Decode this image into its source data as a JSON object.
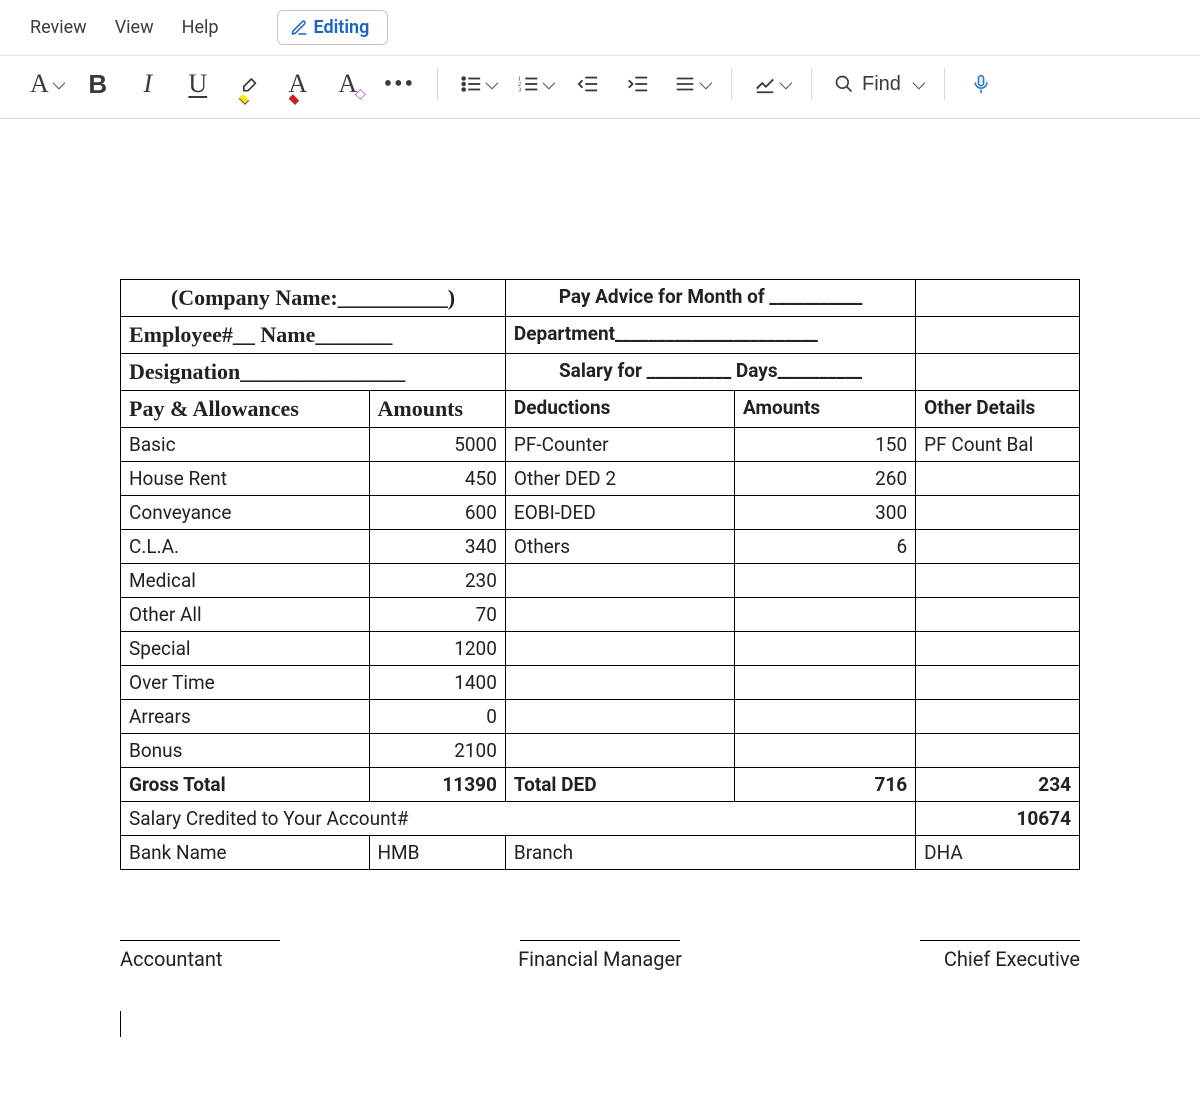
{
  "menubar": {
    "review": "Review",
    "view": "View",
    "help": "Help",
    "editing": "Editing"
  },
  "toolbar": {
    "find_label": "Find"
  },
  "doc": {
    "company_label": "(Company Name:__________)",
    "pay_advice_label": "Pay Advice for Month of ___________",
    "employee_label": "Employee#__   Name_______",
    "department_label": "Department________________________",
    "designation_label": "Designation_______________",
    "salary_for_label": "Salary for __________ Days__________",
    "hdr_pay_allow": "Pay & Allowances",
    "hdr_amounts1": "Amounts",
    "hdr_deductions": "Deductions",
    "hdr_amounts2": "Amounts",
    "hdr_other_details": "Other Details",
    "rows_allow": [
      {
        "label": "Basic",
        "amount": "5000"
      },
      {
        "label": "House Rent",
        "amount": "450"
      },
      {
        "label": "Conveyance",
        "amount": "600"
      },
      {
        "label": "C.L.A.",
        "amount": "340"
      },
      {
        "label": "Medical",
        "amount": "230"
      },
      {
        "label": "Other All",
        "amount": "70"
      },
      {
        "label": "Special",
        "amount": "1200"
      },
      {
        "label": "Over Time",
        "amount": "1400"
      },
      {
        "label": "Arrears",
        "amount": "0"
      },
      {
        "label": "Bonus",
        "amount": "2100"
      }
    ],
    "rows_ded": [
      {
        "label": "PF-Counter",
        "amount": "150"
      },
      {
        "label": "Other DED 2",
        "amount": "260"
      },
      {
        "label": "EOBI-DED",
        "amount": "300"
      },
      {
        "label": "Others",
        "amount": "6"
      }
    ],
    "other_details_row0": "PF Count Bal",
    "gross_total_label": "Gross Total",
    "gross_total_amount": "11390",
    "total_ded_label": "Total DED",
    "total_ded_amount": "716",
    "other_total": "234",
    "salary_credited_label": "Salary Credited to Your Account#",
    "net_salary": "10674",
    "bank_name_label": "Bank Name",
    "bank_name_value": "HMB",
    "branch_label": "Branch",
    "branch_value": "DHA",
    "sig_accountant": "Accountant",
    "sig_fin_mgr": "Financial Manager",
    "sig_ceo": "Chief Executive"
  }
}
